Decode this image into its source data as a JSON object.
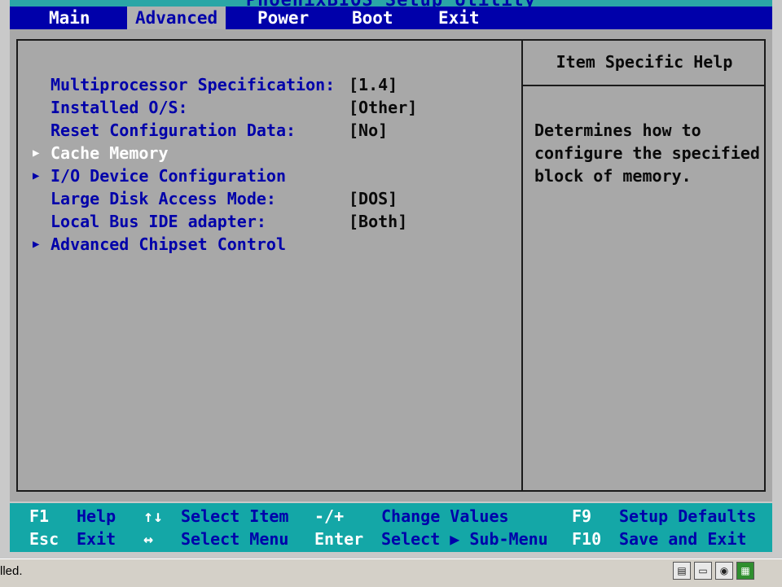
{
  "window_title": "PhoenixBIOS Setup Utility",
  "menu": {
    "tabs": [
      {
        "label": "Main",
        "active": false
      },
      {
        "label": "Advanced",
        "active": true
      },
      {
        "label": "Power",
        "active": false
      },
      {
        "label": "Boot",
        "active": false
      },
      {
        "label": "Exit",
        "active": false
      }
    ]
  },
  "settings": [
    {
      "label": "Multiprocessor Specification:",
      "value": "[1.4]",
      "submenu": false,
      "selected": false
    },
    {
      "label": "Installed O/S:",
      "value": "[Other]",
      "submenu": false,
      "selected": false
    },
    {
      "label": "Reset Configuration Data:",
      "value": "[No]",
      "submenu": false,
      "selected": false
    },
    {
      "label": "Cache Memory",
      "value": "",
      "submenu": true,
      "selected": true
    },
    {
      "label": "I/O Device Configuration",
      "value": "",
      "submenu": true,
      "selected": false
    },
    {
      "label": "Large Disk Access Mode:",
      "value": "[DOS]",
      "submenu": false,
      "selected": false
    },
    {
      "label": "Local Bus IDE adapter:",
      "value": "[Both]",
      "submenu": false,
      "selected": false
    },
    {
      "label": "Advanced Chipset Control",
      "value": "",
      "submenu": true,
      "selected": false
    }
  ],
  "help": {
    "title": "Item Specific Help",
    "text": "Determines how to\nconfigure the specified\nblock of memory."
  },
  "keys": {
    "f1": "F1",
    "f1_desc": "Help",
    "updown": "↑↓",
    "updown_desc": "Select Item",
    "minusplus": "-/+",
    "minusplus_desc": "Change Values",
    "f9": "F9",
    "f9_desc": "Setup Defaults",
    "esc": "Esc",
    "esc_desc": "Exit",
    "leftright": "↔",
    "leftright_desc": "Select Menu",
    "enter": "Enter",
    "enter_desc": "Select ▶ Sub-Menu",
    "f10": "F10",
    "f10_desc": "Save and Exit"
  },
  "status": {
    "text": "lled."
  },
  "colors": {
    "menu_bg": "#0000aa",
    "frame_bg": "#a8a8a8",
    "keybar_bg": "#14a7a7",
    "label_color": "#0000aa",
    "selected_color": "#ffffff"
  }
}
